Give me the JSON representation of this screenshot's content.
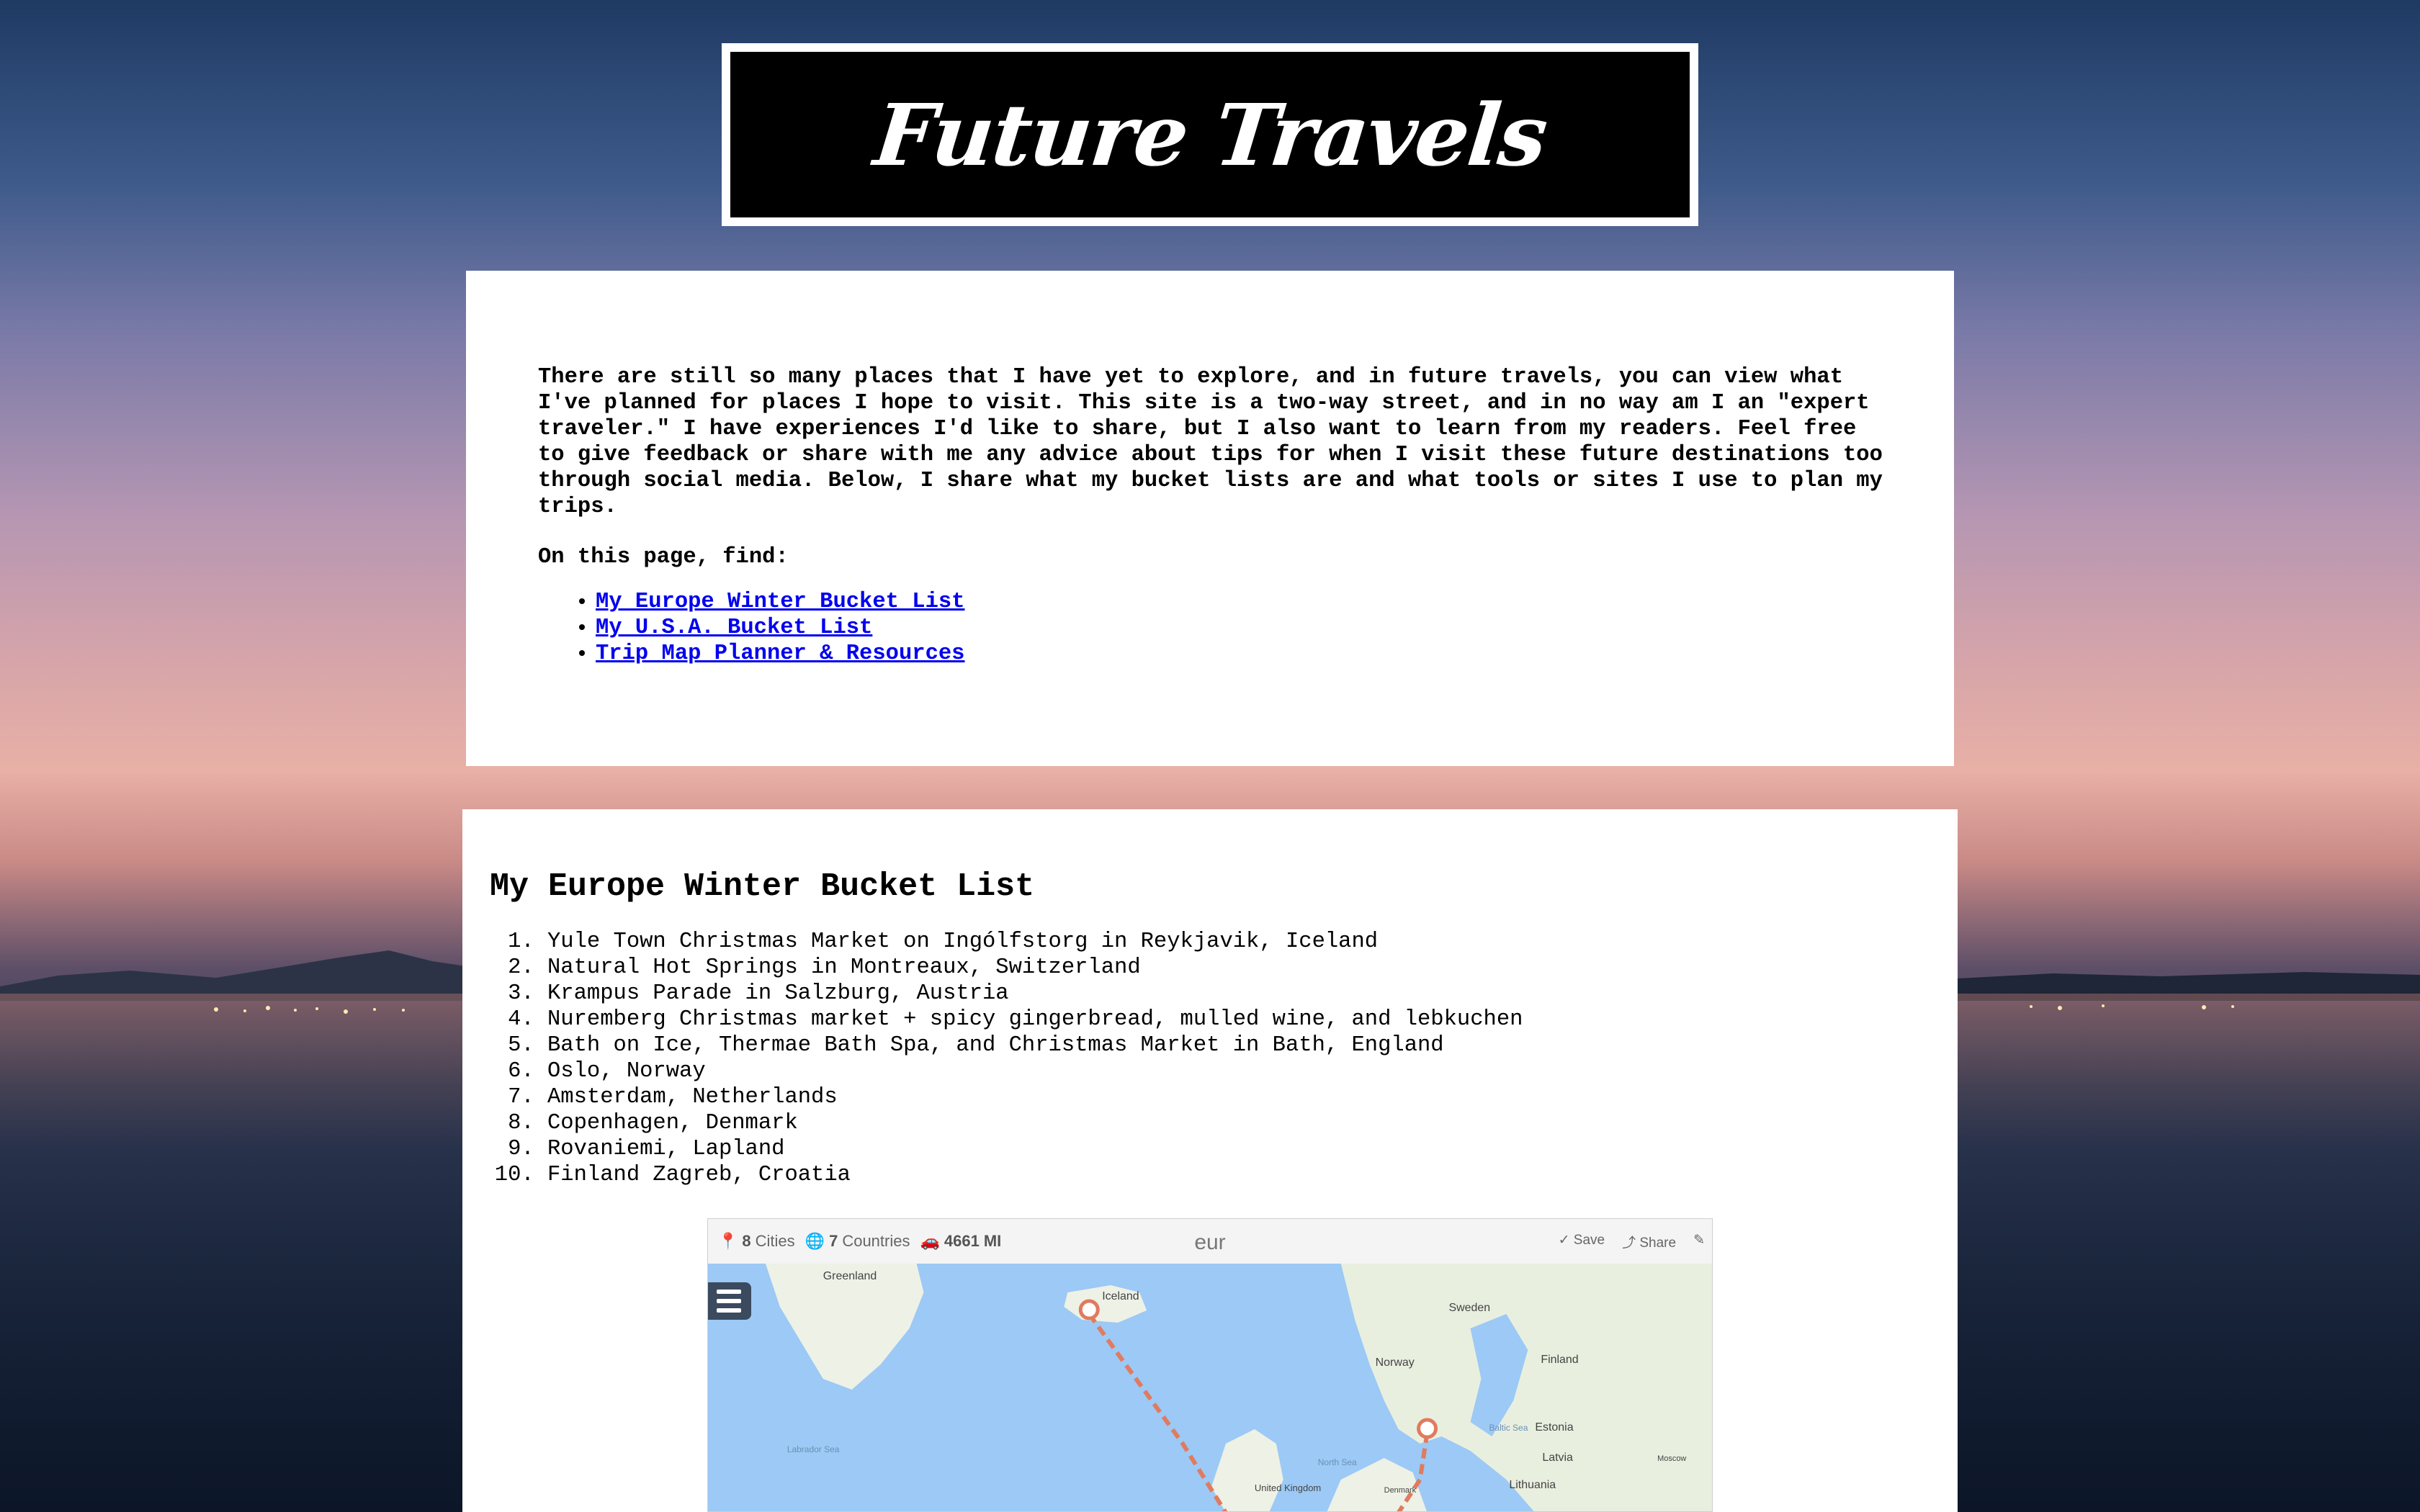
{
  "site": {
    "title": "Future Travels"
  },
  "intro": {
    "paragraph": "There are still so many places that I have yet to explore, and in future travels, you can view what I've planned for places I hope to visit. This site is a two-way street, and in no way am I an \"expert traveler.\" I have experiences I'd like to share, but I also want to learn from my readers. Feel free to give feedback or share with me any advice about tips for when I visit these future destinations too through social media. Below, I share what my bucket lists are and what tools or sites I use to plan my trips.",
    "find_label": "On this page, find:",
    "links": [
      "My Europe Winter Bucket List",
      "My U.S.A. Bucket List",
      "Trip Map Planner & Resources"
    ]
  },
  "europe": {
    "heading": "My Europe Winter Bucket List",
    "items": [
      "Yule Town Christmas Market on Ingólfstorg in Reykjavik, Iceland",
      "Natural Hot Springs in Montreaux, Switzerland",
      "Krampus Parade in Salzburg, Austria",
      "Nuremberg Christmas market + spicy gingerbread, mulled wine, and lebkuchen",
      "Bath on Ice, Thermae Bath Spa, and Christmas Market in Bath, England",
      "Oslo, Norway",
      "Amsterdam, Netherlands",
      "Copenhagen, Denmark",
      "Rovaniemi, Lapland",
      "Finland Zagreb, Croatia"
    ]
  },
  "map": {
    "cities": "8",
    "cities_label": "Cities",
    "countries": "7",
    "countries_label": "Countries",
    "distance": "4661",
    "distance_unit": "MI",
    "name": "eur",
    "save_label": "Save",
    "share_label": "Share",
    "labels": {
      "greenland": "Greenland",
      "iceland": "Iceland",
      "sweden": "Sweden",
      "norway": "Norway",
      "finland": "Finland",
      "estonia": "Estonia",
      "latvia": "Latvia",
      "lithuania": "Lithuania",
      "labrador": "Labrador Sea",
      "north_sea": "North Sea",
      "baltic": "Baltic Sea",
      "uk": "United Kingdom",
      "denmark": "Denmark",
      "moscow": "Moscow"
    },
    "colors": {
      "water": "#9cc9f5",
      "land": "#eef1e6",
      "route": "#e07b5f"
    }
  }
}
